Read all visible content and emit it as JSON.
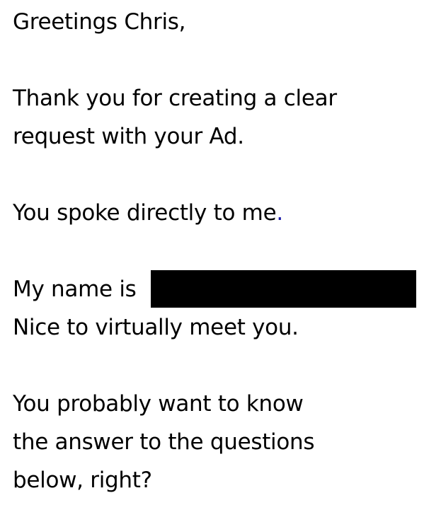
{
  "letter": {
    "greeting": "Greetings Chris,",
    "thanks_line_1": "Thank you for creating a clear",
    "thanks_line_2": "request with your Ad.",
    "spoke_text": "You spoke directly to me",
    "spoke_period": ".",
    "name_intro": "My name is",
    "nice_line": "Nice to virtually meet you.",
    "question_line_1": "You probably want to know",
    "question_line_2": "the answer to the questions",
    "question_line_3": "below, right?"
  },
  "colors": {
    "text": "#000000",
    "background": "#ffffff",
    "period_accent": "#1a1aa6",
    "redaction": "#000000"
  }
}
